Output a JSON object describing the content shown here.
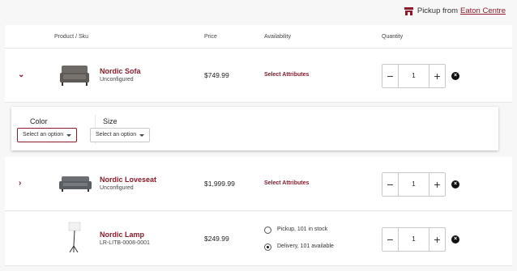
{
  "pickup": {
    "prefix": "Pickup from",
    "store": "Eaton Centre",
    "icon": "store-icon"
  },
  "table": {
    "headers": {
      "product": "Product / Sku",
      "price": "Price",
      "availability": "Availability",
      "quantity": "Quantity"
    }
  },
  "items": [
    {
      "name": "Nordic Sofa",
      "sku": "Unconfigured",
      "price": "$749.99",
      "availability": "Select Attributes",
      "quantity": "1",
      "expanded": true
    },
    {
      "name": "Nordic Loveseat",
      "sku": "Unconfigured",
      "price": "$1,999.99",
      "availability": "Select Attributes",
      "quantity": "1",
      "expanded": false
    },
    {
      "name": "Nordic Lamp",
      "sku": "LR-LITB-0008-0001",
      "price": "$249.99",
      "quantity": "1",
      "fulfillment": [
        {
          "label": "Pickup, 101 in stock",
          "checked": false
        },
        {
          "label": "Delivery, 101 available",
          "checked": true
        }
      ]
    }
  ],
  "attributes": {
    "color": {
      "label": "Color",
      "value": "Select an option"
    },
    "size": {
      "label": "Size",
      "value": "Select an option"
    }
  },
  "colors": {
    "accent": "#8b1a2b",
    "background": "#f7f7f7"
  }
}
